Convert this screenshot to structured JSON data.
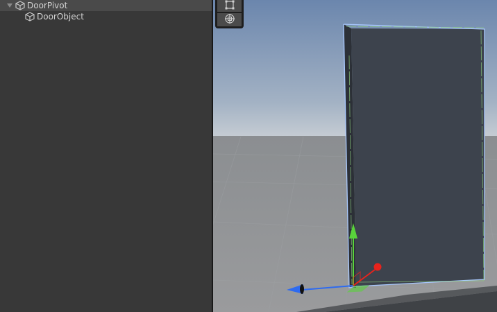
{
  "hierarchy": {
    "items": [
      {
        "label": "DoorPivot",
        "icon": "gameobject-cube-icon",
        "expanded": true
      },
      {
        "label": "DoorObject",
        "icon": "gameobject-cube-icon"
      }
    ]
  },
  "scene_tools": [
    {
      "icon": "rect-tool-icon"
    },
    {
      "icon": "transform-tool-icon"
    }
  ],
  "colors": {
    "panel_bg": "#383838",
    "hierarchy_row_highlight": "#4a4a4a",
    "text": "#d2d2d2",
    "sky_top": "#6b86ad",
    "sky_horizon": "#c5ccd3",
    "ground": "#8e9194",
    "door_face": "#3d434d",
    "selection_outline": "#a9c9ff",
    "gizmo_x": "#e8231c",
    "gizmo_y": "#59d33b",
    "gizmo_z": "#2e6bf0"
  }
}
